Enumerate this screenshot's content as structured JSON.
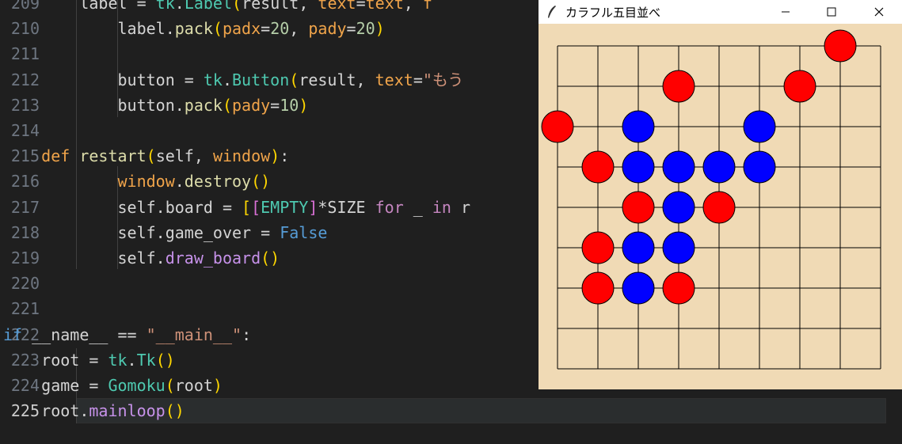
{
  "editor": {
    "lines": [
      {
        "n": "209",
        "tokens": [
          [
            "def",
            "        "
          ],
          [
            "def",
            "label"
          ],
          [
            "def",
            " = "
          ],
          [
            "cls",
            "tk"
          ],
          [
            "def",
            "."
          ],
          [
            "cls",
            "Label"
          ],
          [
            "br1",
            "("
          ],
          [
            "def",
            "result, "
          ],
          [
            "ora",
            "text"
          ],
          [
            "def",
            "="
          ],
          [
            "ora",
            "text"
          ],
          [
            "def",
            ", "
          ],
          [
            "ora",
            "f"
          ]
        ]
      },
      {
        "n": "210",
        "tokens": [
          [
            "def",
            "            label."
          ],
          [
            "fn",
            "pack"
          ],
          [
            "br1",
            "("
          ],
          [
            "ora",
            "padx"
          ],
          [
            "def",
            "="
          ],
          [
            "num",
            "20"
          ],
          [
            "def",
            ", "
          ],
          [
            "ora",
            "pady"
          ],
          [
            "def",
            "="
          ],
          [
            "num",
            "20"
          ],
          [
            "br1",
            ")"
          ]
        ]
      },
      {
        "n": "211",
        "tokens": []
      },
      {
        "n": "212",
        "tokens": [
          [
            "def",
            "            button = "
          ],
          [
            "cls",
            "tk"
          ],
          [
            "def",
            "."
          ],
          [
            "cls",
            "Button"
          ],
          [
            "br1",
            "("
          ],
          [
            "def",
            "result, "
          ],
          [
            "ora",
            "text"
          ],
          [
            "def",
            "="
          ],
          [
            "str",
            "\"もう"
          ]
        ]
      },
      {
        "n": "213",
        "tokens": [
          [
            "def",
            "            button."
          ],
          [
            "fn",
            "pack"
          ],
          [
            "br1",
            "("
          ],
          [
            "ora",
            "pady"
          ],
          [
            "def",
            "="
          ],
          [
            "num",
            "10"
          ],
          [
            "br1",
            ")"
          ]
        ]
      },
      {
        "n": "214",
        "tokens": []
      },
      {
        "n": "215",
        "tokens": [
          [
            "kwb",
            "    "
          ],
          [
            "ora",
            "def"
          ],
          [
            "def",
            " "
          ],
          [
            "fn",
            "restart"
          ],
          [
            "br1",
            "("
          ],
          [
            "def",
            "self, "
          ],
          [
            "ora",
            "window"
          ],
          [
            "br1",
            ")"
          ],
          [
            "def",
            ":"
          ]
        ]
      },
      {
        "n": "216",
        "tokens": [
          [
            "def",
            "        "
          ],
          [
            "ora",
            "    window"
          ],
          [
            "def",
            "."
          ],
          [
            "fn",
            "destroy"
          ],
          [
            "br1",
            "()"
          ]
        ]
      },
      {
        "n": "217",
        "tokens": [
          [
            "def",
            "            self.board = "
          ],
          [
            "br1",
            "["
          ],
          [
            "br2",
            "["
          ],
          [
            "cls",
            "EMPTY"
          ],
          [
            "br2",
            "]"
          ],
          [
            "def",
            "*SIZE "
          ],
          [
            "kw",
            "for"
          ],
          [
            "def",
            " _ "
          ],
          [
            "kw",
            "in"
          ],
          [
            "def",
            " r"
          ]
        ]
      },
      {
        "n": "218",
        "tokens": [
          [
            "def",
            "            self.game_over = "
          ],
          [
            "kwb",
            "False"
          ]
        ]
      },
      {
        "n": "219",
        "tokens": [
          [
            "def",
            "            self."
          ],
          [
            "vio",
            "draw_board"
          ],
          [
            "br1",
            "()"
          ]
        ]
      },
      {
        "n": "220",
        "tokens": []
      },
      {
        "n": "221",
        "tokens": []
      },
      {
        "n": "222",
        "tokens": [
          [
            "kwb",
            "if"
          ],
          [
            "def",
            " __name__ == "
          ],
          [
            "str",
            "\"__main__\""
          ],
          [
            "def",
            ":"
          ]
        ]
      },
      {
        "n": "223",
        "tokens": [
          [
            "def",
            "    root = "
          ],
          [
            "cls",
            "tk"
          ],
          [
            "def",
            "."
          ],
          [
            "cls",
            "Tk"
          ],
          [
            "br1",
            "()"
          ]
        ]
      },
      {
        "n": "224",
        "tokens": [
          [
            "def",
            "    game = "
          ],
          [
            "cls",
            "Gomoku"
          ],
          [
            "br1",
            "("
          ],
          [
            "def",
            "root"
          ],
          [
            "br1",
            ")"
          ]
        ]
      },
      {
        "n": "225",
        "tokens": [
          [
            "def",
            "    root."
          ],
          [
            "vio",
            "mainloop"
          ],
          [
            "br1",
            "()"
          ]
        ]
      }
    ],
    "active_line": "225"
  },
  "window": {
    "title": "カラフル五目並べ",
    "minimize_symbol": "—",
    "maximize_symbol": "☐",
    "close_symbol": "✕"
  },
  "board": {
    "grid_size": 9,
    "background": "#f0dab5",
    "line_color": "#000000",
    "stones": [
      {
        "col": 7,
        "row": 0,
        "color": "red"
      },
      {
        "col": 3,
        "row": 1,
        "color": "red"
      },
      {
        "col": 6,
        "row": 1,
        "color": "red"
      },
      {
        "col": 0,
        "row": 2,
        "color": "red"
      },
      {
        "col": 2,
        "row": 2,
        "color": "blue"
      },
      {
        "col": 5,
        "row": 2,
        "color": "blue"
      },
      {
        "col": 1,
        "row": 3,
        "color": "red"
      },
      {
        "col": 2,
        "row": 3,
        "color": "blue"
      },
      {
        "col": 3,
        "row": 3,
        "color": "blue"
      },
      {
        "col": 4,
        "row": 3,
        "color": "blue"
      },
      {
        "col": 5,
        "row": 3,
        "color": "blue"
      },
      {
        "col": 2,
        "row": 4,
        "color": "red"
      },
      {
        "col": 3,
        "row": 4,
        "color": "blue"
      },
      {
        "col": 4,
        "row": 4,
        "color": "red"
      },
      {
        "col": 1,
        "row": 5,
        "color": "red"
      },
      {
        "col": 2,
        "row": 5,
        "color": "blue"
      },
      {
        "col": 3,
        "row": 5,
        "color": "blue"
      },
      {
        "col": 1,
        "row": 6,
        "color": "red"
      },
      {
        "col": 2,
        "row": 6,
        "color": "blue"
      },
      {
        "col": 3,
        "row": 6,
        "color": "red"
      }
    ]
  }
}
